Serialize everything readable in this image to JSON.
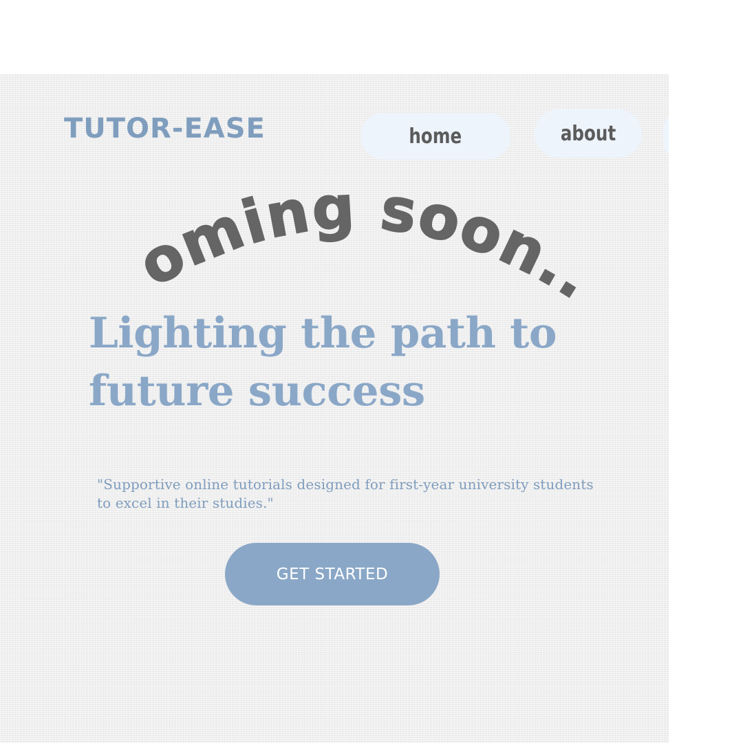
{
  "brand": {
    "name": "TUTOR-EASE"
  },
  "nav": {
    "items": [
      {
        "label": "home"
      },
      {
        "label": "about"
      }
    ]
  },
  "overlay": {
    "text": "coming soon..."
  },
  "hero": {
    "headline_line1": "Lighting the path to",
    "headline_line2": "future success",
    "tagline_line1": "\"Supportive online tutorials designed for first-year university students",
    "tagline_line2": "to excel in their studies.\"",
    "cta_label": "GET STARTED"
  },
  "colors": {
    "accent": "#8aa7c7",
    "logo": "#7f9dbd",
    "nav_pill": "#edf4fc",
    "nav_text": "#5b5b5b",
    "overlay_text": "#656565",
    "background": "#f0f0f0"
  }
}
